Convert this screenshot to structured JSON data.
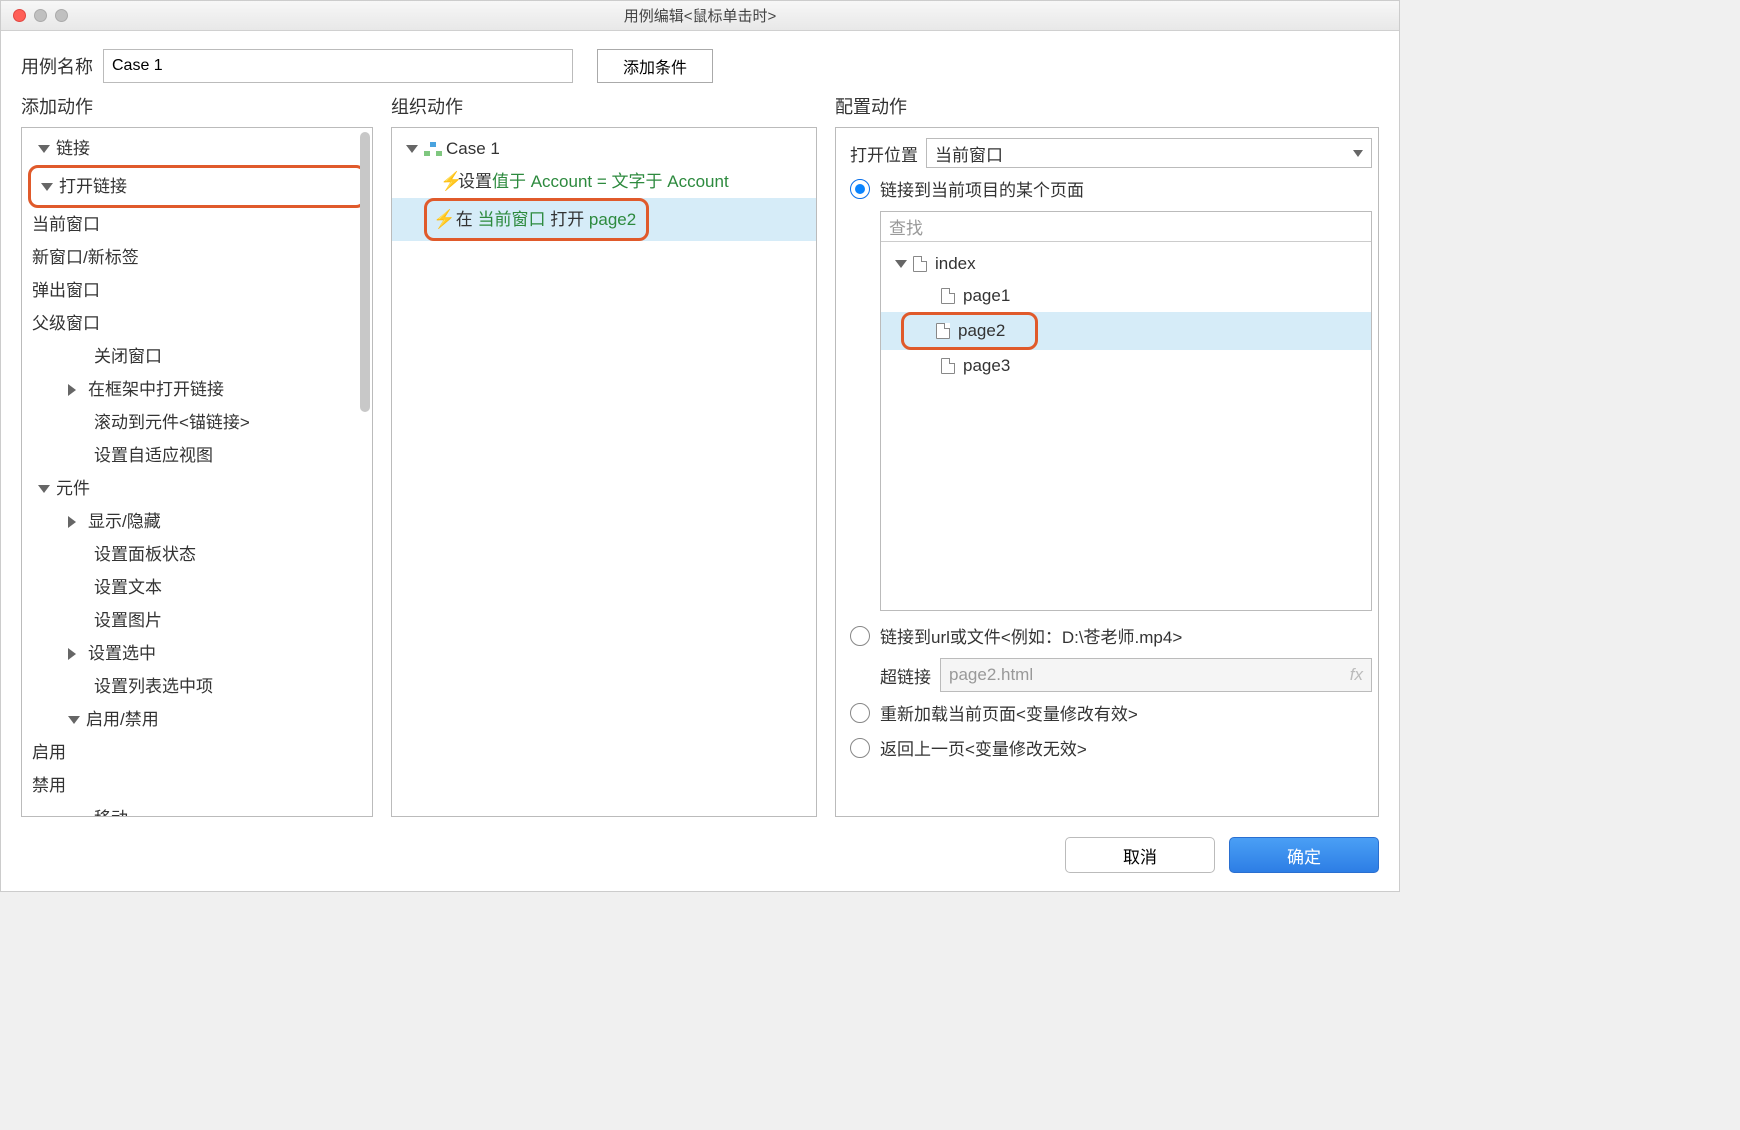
{
  "window": {
    "title": "用例编辑<鼠标单击时>"
  },
  "toprow": {
    "name_label": "用例名称",
    "case_name": "Case 1",
    "add_condition": "添加条件"
  },
  "headers": {
    "add_action": "添加动作",
    "org_action": "组织动作",
    "cfg_action": "配置动作"
  },
  "actions_tree": {
    "links": "链接",
    "open_link": "打开链接",
    "current_window": "当前窗口",
    "new_window": "新窗口/新标签",
    "popup": "弹出窗口",
    "parent": "父级窗口",
    "close_window": "关闭窗口",
    "open_in_frame": "在框架中打开链接",
    "scroll_anchor": "滚动到元件<锚链接>",
    "adaptive_view": "设置自适应视图",
    "widgets": "元件",
    "show_hide": "显示/隐藏",
    "panel_state": "设置面板状态",
    "set_text": "设置文本",
    "set_image": "设置图片",
    "set_selected": "设置选中",
    "set_list_sel": "设置列表选中项",
    "enable_disable": "启用/禁用",
    "enable": "启用",
    "disable": "禁用",
    "move": "移动"
  },
  "org": {
    "case": "Case 1",
    "set_prefix": "设置 ",
    "set_green": "值于 Account = 文字于 Account",
    "l2_pre": "在 ",
    "l2_g1": "当前窗口",
    "l2_mid": " 打开 ",
    "l2_g2": "page2"
  },
  "cfg": {
    "open_in": "打开位置",
    "open_in_val": "当前窗口",
    "r1": "链接到当前项目的某个页面",
    "search_ph": "查找",
    "index": "index",
    "p1": "page1",
    "p2": "page2",
    "p3": "page3",
    "r2": "链接到url或文件<例如：D:\\苍老师.mp4>",
    "url_label": "超链接",
    "url_val": "page2.html",
    "r3": "重新加载当前页面<变量修改有效>",
    "r4": "返回上一页<变量修改无效>"
  },
  "footer": {
    "cancel": "取消",
    "ok": "确定"
  }
}
